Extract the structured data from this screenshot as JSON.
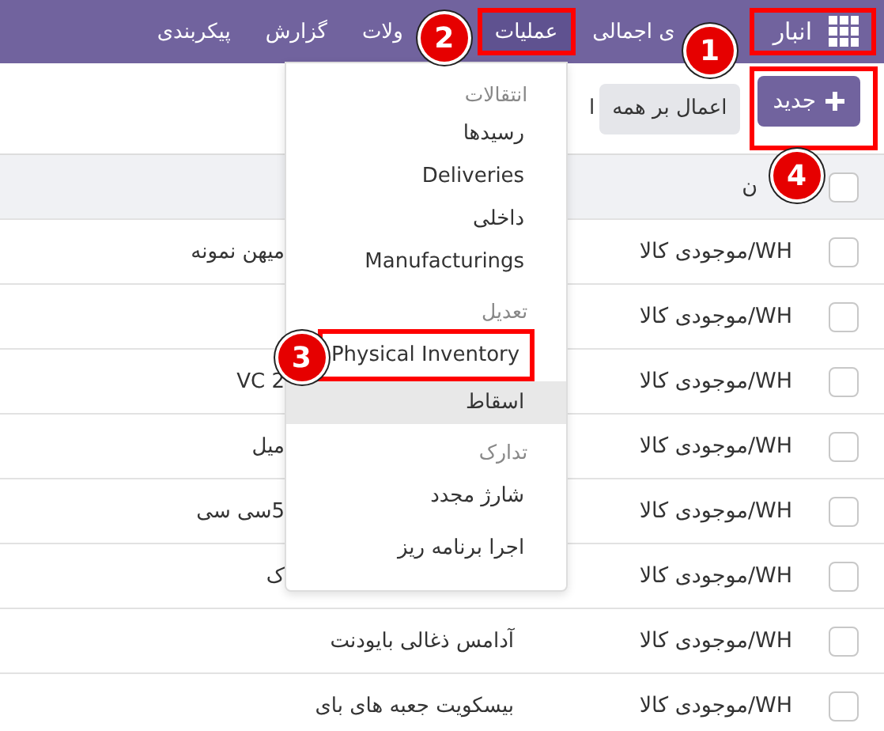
{
  "navbar": {
    "items": [
      {
        "label": "انبار",
        "kind": "app",
        "selected": false,
        "callout": "1"
      },
      {
        "label": "ی اجمالی",
        "kind": "menu",
        "selected": false
      },
      {
        "label": "عملیات",
        "kind": "menu",
        "selected": true,
        "callout": "2",
        "dropdown": {
          "sections": [
            {
              "title": "انتقالات",
              "items": [
                {
                  "label": "رسیدها",
                  "highlighted": false
                },
                {
                  "label": "Deliveries",
                  "highlighted": false
                },
                {
                  "label": "داخلی",
                  "highlighted": false
                },
                {
                  "label": "Manufacturings",
                  "highlighted": false
                }
              ]
            },
            {
              "title": "تعدیل",
              "items": [
                {
                  "label": "Physical Inventory",
                  "highlighted": false,
                  "callout": "3"
                },
                {
                  "label": "اسقاط",
                  "highlighted": true
                }
              ]
            },
            {
              "title": "تدارک",
              "items": [
                {
                  "label": "شارژ مجدد",
                  "highlighted": false
                },
                {
                  "label": "اجرا برنامه ریز",
                  "highlighted": false
                }
              ]
            }
          ]
        }
      },
      {
        "label": "ولات",
        "kind": "menu",
        "selected": false
      },
      {
        "label": "گزارش",
        "kind": "menu",
        "selected": false
      },
      {
        "label": "پیکربندی",
        "kind": "menu",
        "selected": false
      }
    ]
  },
  "toolbar": {
    "new_button": {
      "label": "جدید",
      "callout": "4"
    },
    "apply_button": {
      "label": "اعمال بر همه"
    },
    "cut_label": "ا"
  },
  "table": {
    "header": {
      "checked": false,
      "column_2": "ن"
    },
    "rows": [
      {
        "checked": false,
        "location": "WH/موجودی کالا",
        "product": "میهن نمونه",
        "covered": true
      },
      {
        "checked": false,
        "location": "WH/موجودی کالا"
      },
      {
        "checked": false,
        "location": "WH/موجودی کالا",
        "product": "VC 2",
        "covered": true
      },
      {
        "checked": false,
        "location": "WH/موجودی کالا",
        "product": "میل",
        "covered": true
      },
      {
        "checked": false,
        "location": "WH/موجودی کالا",
        "product": "5سی سی",
        "covered": true
      },
      {
        "checked": false,
        "location": "WH/موجودی کالا",
        "product": "ک",
        "covered": true
      },
      {
        "checked": false,
        "location": "WH/موجودی کالا",
        "product": "آدامس ذغالی بایودنت"
      },
      {
        "checked": false,
        "location": "WH/موجودی کالا",
        "product": "بیسکویت جعبه های بای"
      }
    ]
  }
}
